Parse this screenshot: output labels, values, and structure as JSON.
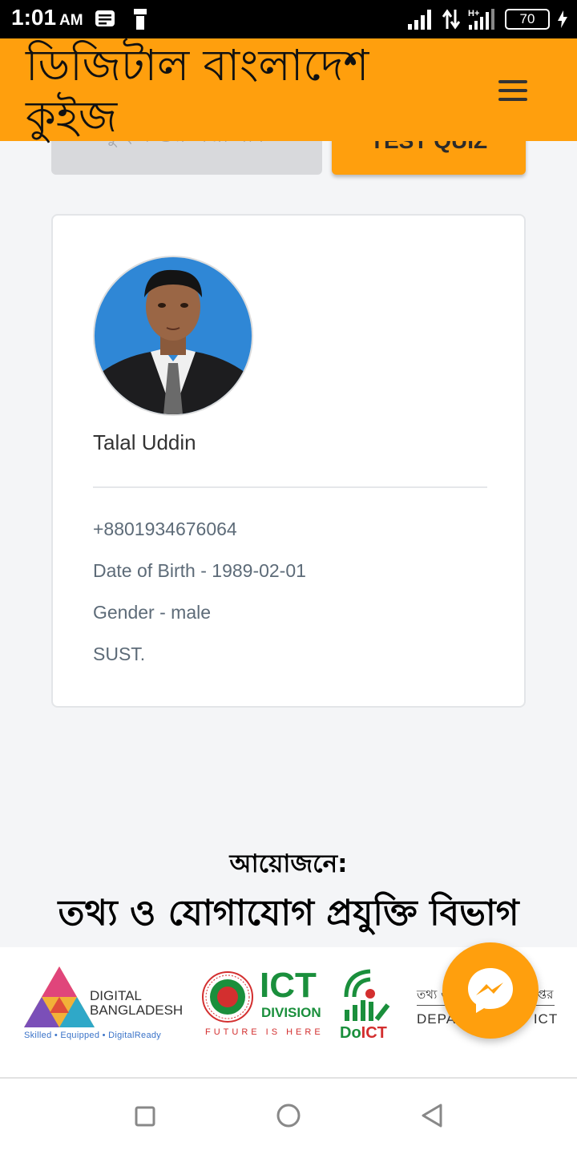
{
  "status_bar": {
    "time": "1:01",
    "ampm": "AM",
    "battery": "70"
  },
  "header": {
    "title": "ডিজিটাল বাংলাদেশ কুইজ",
    "menu_icon": "hamburger-menu-icon"
  },
  "actions": {
    "start_quiz_label": "কুইজ শুরু করা যাক",
    "test_quiz_label": "TEST QUIZ"
  },
  "profile": {
    "name": "Talal Uddin",
    "phone": "+8801934676064",
    "dob": "Date of Birth - 1989-02-01",
    "gender": "Gender - male",
    "institution": "SUST."
  },
  "organizer": {
    "label": "আয়োজনে:",
    "name": "তথ্য ও যোগাযোগ প্রযুক্তি বিভাগ"
  },
  "logos": {
    "digital_bangladesh": {
      "line1": "DIGITAL",
      "line2": "BANGLADESH",
      "tagline": "Skilled • Equipped • DigitalReady"
    },
    "ict_division": {
      "big": "ICT",
      "small": "DIVISION",
      "tagline": "FUTURE IS HERE"
    },
    "doict": {
      "do": "Do",
      "ict": "ICT"
    },
    "department": {
      "top_left": "তথ্য ও",
      "top_right": "দপ্তর",
      "bottom_left": "DEPA",
      "bottom_right": "ICT"
    }
  },
  "colors": {
    "accent": "#ff9f0d",
    "background": "#f4f5f7",
    "ict_green": "#1a8f3c",
    "ict_red": "#d32f2f"
  },
  "icons": {
    "messenger": "messenger-icon",
    "nav_recents": "square-recents-icon",
    "nav_home": "circle-home-icon",
    "nav_back": "triangle-back-icon"
  }
}
